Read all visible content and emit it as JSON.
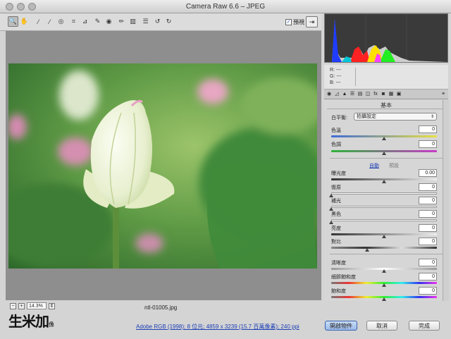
{
  "window": {
    "title": "Camera Raw 6.6  –  JPEG"
  },
  "toolbar": {
    "tools": [
      {
        "name": "zoom-tool-icon",
        "glyph": "🔍"
      },
      {
        "name": "hand-tool-icon",
        "glyph": "✋"
      },
      {
        "name": "white-balance-tool-icon",
        "glyph": "⁄"
      },
      {
        "name": "color-sampler-tool-icon",
        "glyph": "⁄"
      },
      {
        "name": "targeted-adjustment-tool-icon",
        "glyph": "◎"
      },
      {
        "name": "crop-tool-icon",
        "glyph": "⌗"
      },
      {
        "name": "straighten-tool-icon",
        "glyph": "⊿"
      },
      {
        "name": "spot-removal-tool-icon",
        "glyph": "✎"
      },
      {
        "name": "red-eye-tool-icon",
        "glyph": "◉"
      },
      {
        "name": "adjustment-brush-icon",
        "glyph": "✏"
      },
      {
        "name": "graduated-filter-icon",
        "glyph": "▥"
      },
      {
        "name": "preferences-icon",
        "glyph": "☰"
      },
      {
        "name": "rotate-ccw-icon",
        "glyph": "↺"
      },
      {
        "name": "rotate-cw-icon",
        "glyph": "↻"
      }
    ],
    "preview_label": "預視",
    "preview_checked": "✓"
  },
  "bottom": {
    "zoom_value": "14.3%",
    "zoom_out": "−",
    "zoom_in": "+",
    "filename": "ntl-01005.jpg",
    "workflow_link": "Adobe RGB (1998); 8 位元; 4859 x 3239 (15.7 百萬像素); 240 ppi",
    "open_button": "開啟物件",
    "cancel_button": "取消",
    "done_button": "完成",
    "watermark": "生米加",
    "watermark_sub": "像"
  },
  "readout": {
    "r_label": "R:",
    "g_label": "G:",
    "b_label": "B:",
    "r": "---",
    "g": "---",
    "b": "---"
  },
  "panel": {
    "title": "基本",
    "wb_label": "白平衡:",
    "wb_value": "拍攝設定",
    "temp_label": "色溫",
    "temp_value": "0",
    "tint_label": "色調",
    "tint_value": "0",
    "auto_label": "自動",
    "default_label": "預設",
    "exposure_label": "曝光度",
    "exposure_value": "0.00",
    "recovery_label": "復原",
    "recovery_value": "0",
    "fill_label": "補光",
    "fill_value": "0",
    "blacks_label": "黑色",
    "blacks_value": "0",
    "brightness_label": "亮度",
    "brightness_value": "0",
    "contrast_label": "對比",
    "contrast_value": "0",
    "clarity_label": "清晰度",
    "clarity_value": "0",
    "vibrance_label": "細節飽和度",
    "vibrance_value": "0",
    "saturation_label": "飽和度",
    "saturation_value": "0"
  },
  "colors": {
    "accent": "#1d3fb5",
    "primary_button": "#9dbbe8"
  }
}
